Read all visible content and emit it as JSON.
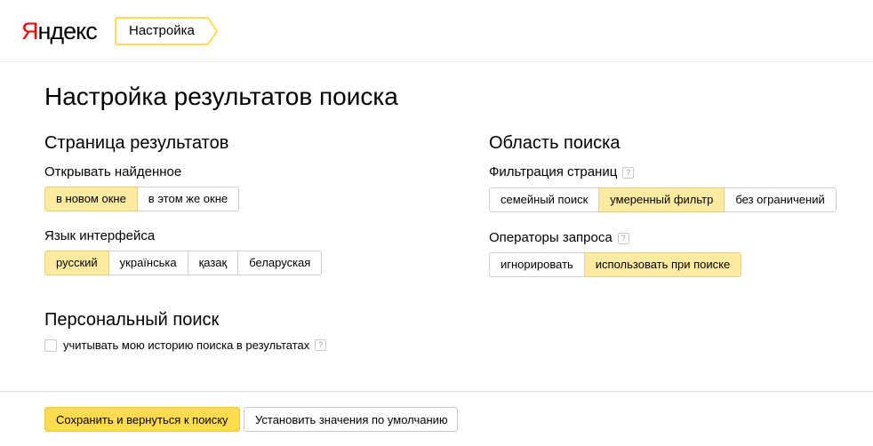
{
  "header": {
    "logo_first": "Я",
    "logo_rest": "ндекс",
    "breadcrumb": "Настройка",
    "accent_color": "#ffdb4d"
  },
  "page_title": "Настройка результатов поиска",
  "left": {
    "section_title": "Страница результатов",
    "open_found": {
      "label": "Открывать найденное",
      "options": [
        "в новом окне",
        "в этом же окне"
      ],
      "selected": "в новом окне"
    },
    "interface_language": {
      "label": "Язык интерфейса",
      "options": [
        "русский",
        "українська",
        "қазақ",
        "беларуская"
      ],
      "selected": "русский"
    }
  },
  "right": {
    "section_title": "Область поиска",
    "page_filter": {
      "label": "Фильтрация страниц",
      "help": "?",
      "options": [
        "семейный поиск",
        "умеренный фильтр",
        "без ограничений"
      ],
      "selected": "умеренный фильтр"
    },
    "query_operators": {
      "label": "Операторы запроса",
      "help": "?",
      "options": [
        "игнорировать",
        "использовать при поиске"
      ],
      "selected": "использовать при поиске"
    }
  },
  "personal": {
    "section_title": "Персональный поиск",
    "history_checkbox_label": "учитывать мою историю поиска в результатах",
    "history_checked": false,
    "help": "?"
  },
  "footer": {
    "save_label": "Сохранить и вернуться к поиску",
    "defaults_label": "Установить значения по умолчанию"
  }
}
